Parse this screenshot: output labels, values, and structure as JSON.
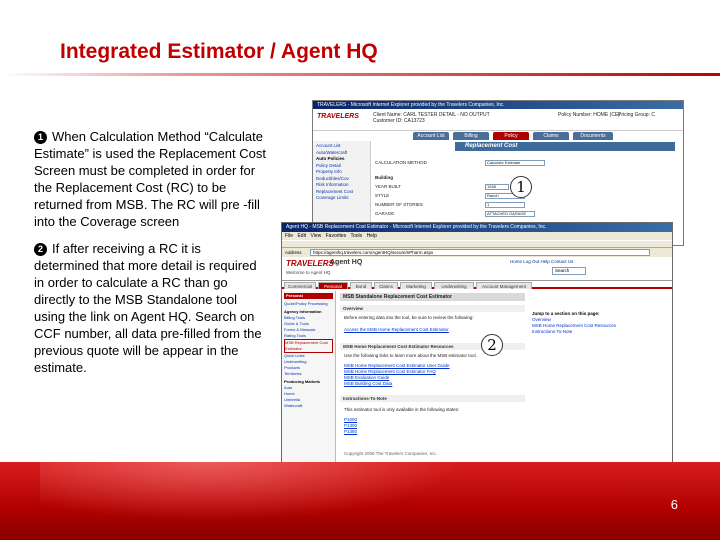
{
  "slide": {
    "title": "Integrated Estimator / Agent HQ",
    "page_number": "6",
    "paragraphs": [
      {
        "marker": "1",
        "text": "When Calculation Method “Calculate Estimate” is used the Replacement Cost Screen must be completed in order for the Replacement Cost (RC) to be returned from MSB.  The RC will pre -fill into the Coverage screen"
      },
      {
        "marker": "2",
        "text": "If after receiving a RC it is determined that more detail is required in order to calculate a RC than go directly to the MSB Standalone tool using the link on Agent HQ.  Search on CCF number, all data pre-filled from the previous quote will be appear in the estimate."
      }
    ],
    "callouts": [
      "1",
      "2"
    ]
  },
  "screenshot1": {
    "window_title": "TRAVELERS - Microsoft Internet Explorer provided by the Travelers Companies, Inc.",
    "logo": "TRAVELERS",
    "client": "Client Name: CARL TESTER DETAIL - NO OUTPUT",
    "customer": "Customer ID: CA13723",
    "policy": "Policy Number: HOME (CE)",
    "group": "Pricing Group: C",
    "tabs": [
      "Account List",
      "Billing",
      "Policy",
      "Claims",
      "Documents"
    ],
    "banner": "Replacement Cost",
    "side_items": [
      "Account List",
      "Auto/Watercraft",
      "Auto Policies",
      "Policy Detail",
      "Property Info",
      "Deductibles/Cov",
      "Risk Information",
      "Replacement Cost",
      "Coverage Limits"
    ],
    "fields": [
      {
        "label": "CALCULATION METHOD",
        "value": "Calculate Estimate"
      },
      {
        "label": "Building",
        "value": ""
      },
      {
        "label": "YEAR BUILT",
        "value": "1948"
      },
      {
        "label": "STYLE",
        "value": "Ranch"
      },
      {
        "label": "NUMBER OF STORIES",
        "value": "1"
      },
      {
        "label": "GARAGE",
        "value": "ATTACHED GARAGE"
      }
    ]
  },
  "screenshot2": {
    "window_title": "Agent HQ - MSB Replacement Cost Estimator - Microsoft Internet Explorer provided by the Travelers Companies, Inc.",
    "menu": [
      "File",
      "Edit",
      "View",
      "Favorites",
      "Tools",
      "Help"
    ],
    "address_label": "Address",
    "address": "https://agenthq.travelers.com/AgentHQ/secure/nPharm.aspx",
    "logo": "TRAVELERS",
    "app_name": "Agent HQ",
    "welcome": "Welcome to Agent HQ",
    "top_links": "Home  Log Out  Help  Contact Us",
    "search_placeholder": "Search",
    "tabs": [
      "Commercial",
      "Personal",
      "Bond",
      "Claims",
      "Marketing",
      "Underwriting",
      "Account Management"
    ],
    "nav_head": "Personal",
    "nav_items": [
      "Quote/Policy Processing",
      "Agency Information",
      "Billing Tools",
      "Guide & Tools",
      "Forms & Manuals",
      "Rating Tools",
      "MSB Replacement Cost Estimator",
      "Quick Links",
      "Underwriting",
      "Products",
      "Territories",
      "Producing Markets",
      "Auto",
      "Home",
      "Umbrella",
      "Watercraft"
    ],
    "main_title": "MSB Standalone Replacement Cost Estimator",
    "sections": [
      "Overview",
      "MSB Home Replacement Cost Estimator Resources",
      "Instructions-To-Note"
    ],
    "overview_lines": [
      "Before entering data into the tool, be sure to review the following:",
      "Access the MSB Home Replacement Cost Estimator"
    ],
    "resource_lines": [
      "Use the following links to learn more about the MSB estimator tool.",
      "MSB Home Replacement Cost Estimator User Guide",
      "MSB Home Replacement Cost Estimator FAQ",
      "MSB Evaluation Guide",
      "MSB Building Cost Data"
    ],
    "instruction_lines": [
      "This estimator tool is only available in the following states:",
      "P1000",
      "P1300",
      "P1380"
    ],
    "footer_line": "Copyright 2006 The Travelers Companies, Inc.",
    "right_heading": "Jump to a section on this page:",
    "right_links": [
      "Overview",
      "MSB Home Replacement Cost Resources",
      "Instructions-To-Note"
    ],
    "status": "Internet"
  }
}
